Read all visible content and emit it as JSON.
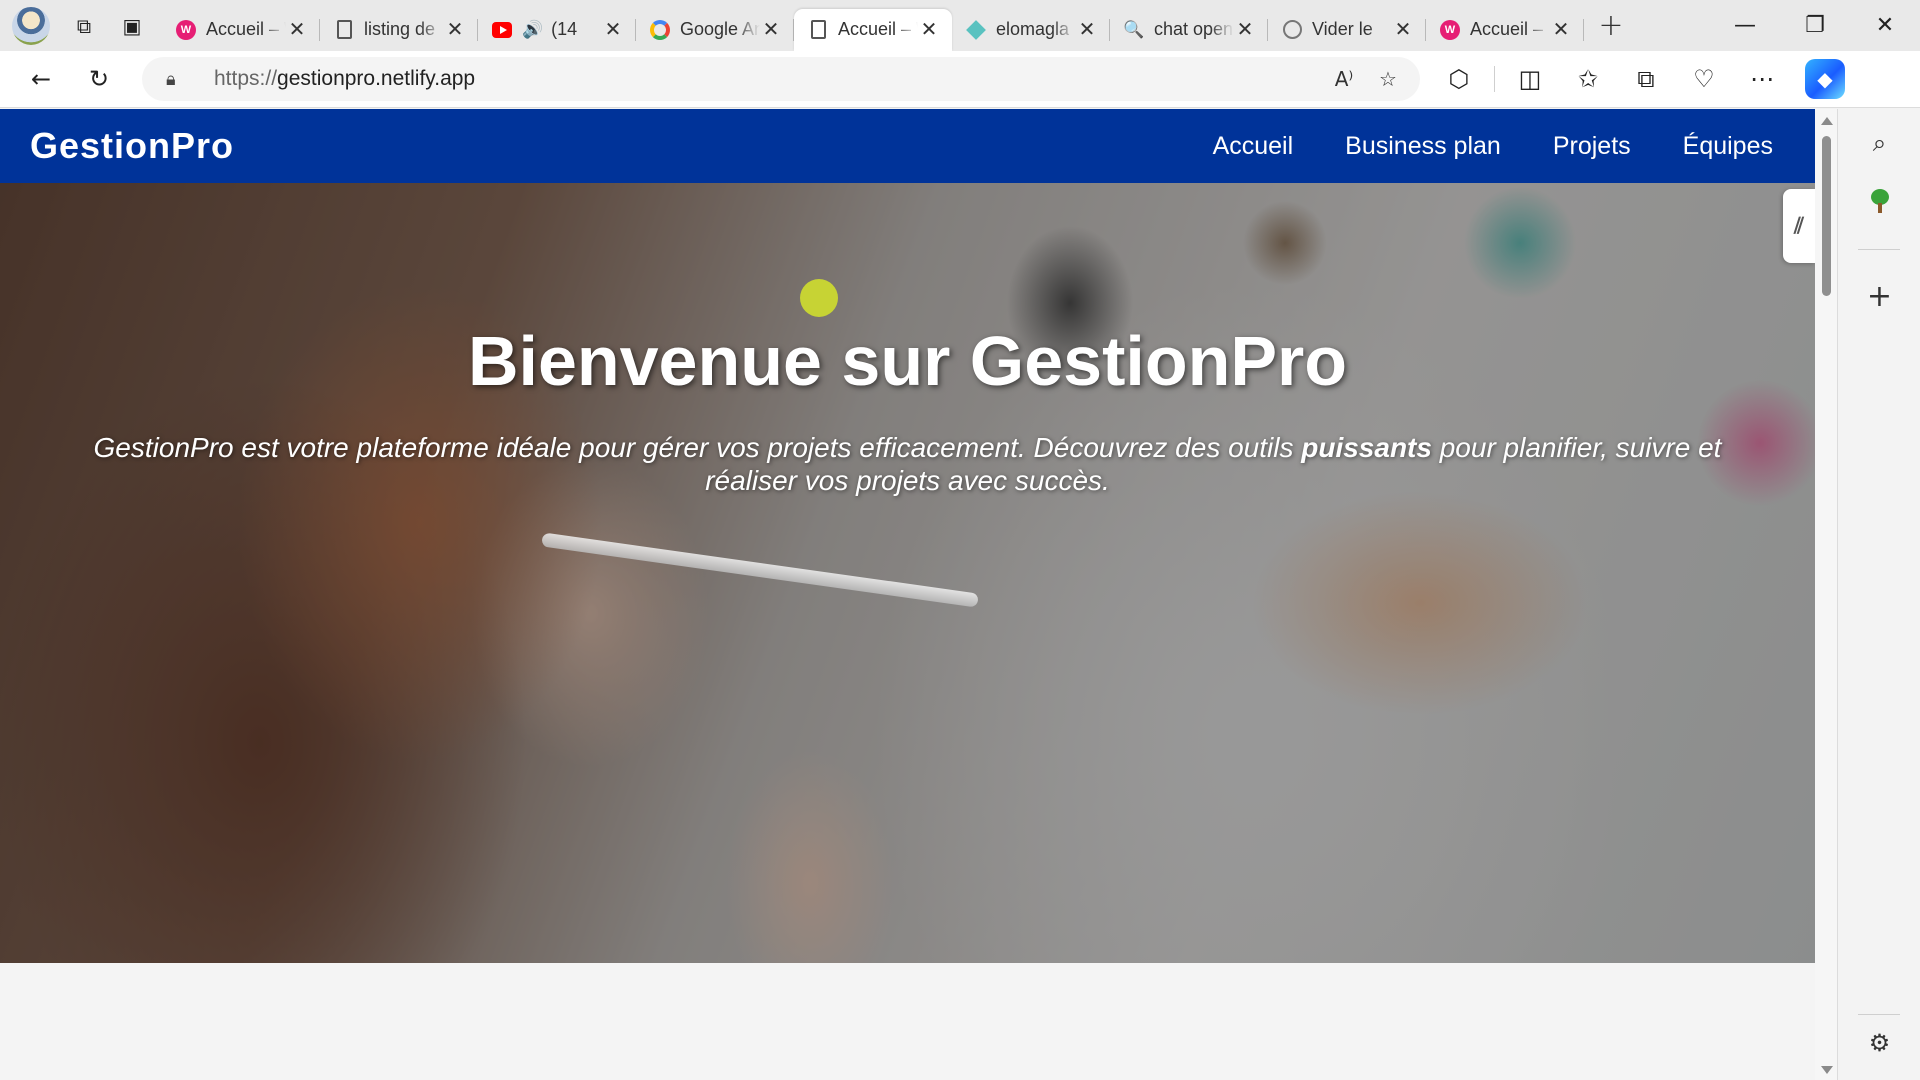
{
  "browser": {
    "tabs": [
      {
        "title": "Accueil – W",
        "favicon": "wordpress-icon",
        "active": false
      },
      {
        "title": "listing de",
        "favicon": "page-icon",
        "active": false
      },
      {
        "title": "(14",
        "favicon": "youtube-icon",
        "active": false,
        "audio": true
      },
      {
        "title": "Google An",
        "favicon": "google-icon",
        "active": false
      },
      {
        "title": "Accueil – W",
        "favicon": "page-icon",
        "active": true
      },
      {
        "title": "elomagla",
        "favicon": "diamond-icon",
        "active": false
      },
      {
        "title": "chat open",
        "favicon": "search-icon",
        "active": false
      },
      {
        "title": "Vider le",
        "favicon": "chatgpt-icon",
        "active": false
      },
      {
        "title": "Accueil –",
        "favicon": "wordpress-icon",
        "active": false
      }
    ],
    "address": {
      "scheme": "https://",
      "host": "gestionpro.netlify.app"
    }
  },
  "site": {
    "logo": "GestionPro",
    "nav": [
      "Accueil",
      "Business plan",
      "Projets",
      "Équipes"
    ],
    "hero": {
      "title": "Bienvenue sur GestionPro",
      "text_before": "GestionPro est votre plateforme idéale pour gérer vos projets efficacement. Découvrez des outils ",
      "text_bold": "puissants",
      "text_after": " pour planifier, suivre et réaliser vos projets avec succès."
    },
    "colors": {
      "nav_bg": "#003399",
      "hero_text": "#ffffff"
    }
  }
}
